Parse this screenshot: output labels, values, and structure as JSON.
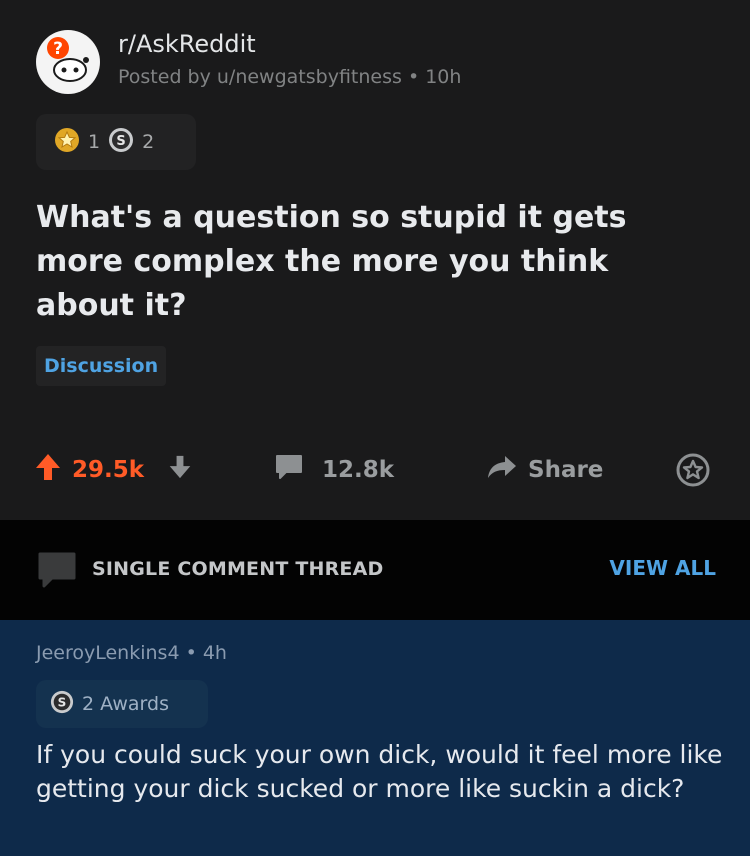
{
  "post": {
    "subreddit": "r/AskReddit",
    "posted_by": "Posted by u/newgatsbyfitness • 10h",
    "award_counts": [
      "1",
      "2"
    ],
    "title": "What's a question so stupid it gets more complex the more you think about it?",
    "flair": "Discussion",
    "upvotes": "29.5k",
    "comments": "12.8k",
    "share_label": "Share"
  },
  "thread": {
    "label": "SINGLE COMMENT THREAD",
    "view_all": "VIEW ALL"
  },
  "comment": {
    "author_line": "JeeroyLenkins4 • 4h",
    "awards": "2 Awards",
    "body": "If you could suck your own dick, would it feel more like getting your dick sucked or more like suckin a dick?"
  },
  "colors": {
    "background": "#1a1a1b",
    "upvote": "#ff5b27",
    "link_blue": "#4fa3e3",
    "comment_bg": "#0e2a4a",
    "thread_bar": "#030303"
  },
  "icons": [
    "subreddit-avatar-icon",
    "gold-award-icon",
    "silver-award-icon",
    "upvote-arrow-icon",
    "downvote-arrow-icon",
    "comment-icon",
    "share-arrow-icon",
    "save-award-icon",
    "chat-bubble-icon"
  ]
}
